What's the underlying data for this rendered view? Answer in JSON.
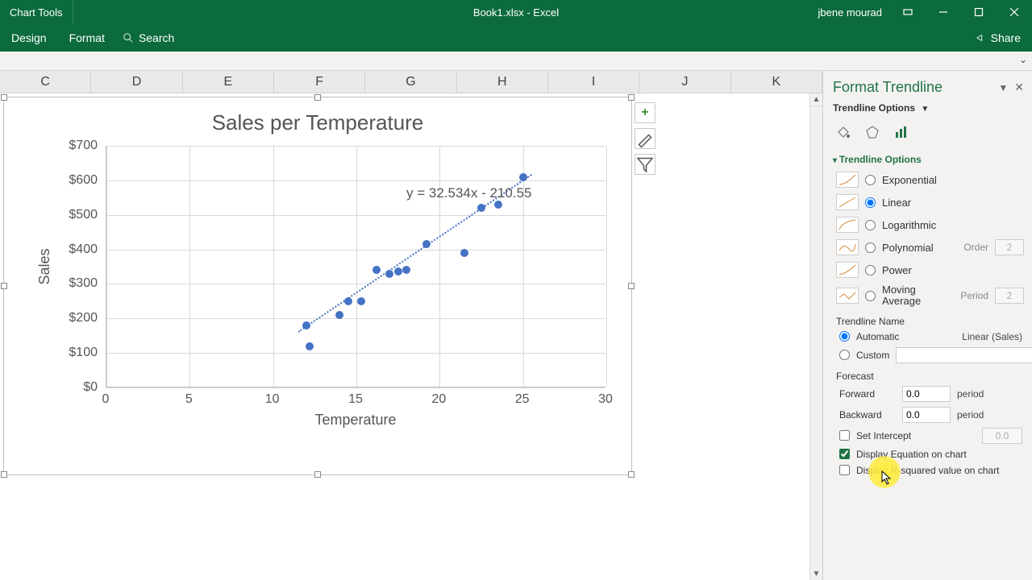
{
  "titlebar": {
    "tools_label": "Chart Tools",
    "doc_name": "Book1.xlsx  -  Excel",
    "user": "jbene mourad"
  },
  "menu": {
    "design": "Design",
    "format": "Format",
    "search": "Search",
    "share": "Share"
  },
  "columns": [
    "C",
    "D",
    "E",
    "F",
    "G",
    "H",
    "I",
    "J",
    "K"
  ],
  "chart_side": {
    "add": "+",
    "brush": "brush",
    "filter": "filter"
  },
  "chart_data": {
    "type": "scatter",
    "title": "Sales per Temperature",
    "xlabel": "Temperature",
    "ylabel": "Sales",
    "xlim": [
      0,
      30
    ],
    "ylim": [
      0,
      700
    ],
    "xticks": [
      0,
      5,
      10,
      15,
      20,
      25,
      30
    ],
    "yticks": [
      0,
      100,
      200,
      300,
      400,
      500,
      600,
      700
    ],
    "ytick_labels": [
      "$0",
      "$100",
      "$200",
      "$300",
      "$400",
      "$500",
      "$600",
      "$700"
    ],
    "series": [
      {
        "name": "Sales",
        "points": [
          {
            "x": 12.0,
            "y": 180
          },
          {
            "x": 12.2,
            "y": 120
          },
          {
            "x": 14.0,
            "y": 210
          },
          {
            "x": 14.5,
            "y": 250
          },
          {
            "x": 15.3,
            "y": 250
          },
          {
            "x": 16.2,
            "y": 340
          },
          {
            "x": 17.0,
            "y": 330
          },
          {
            "x": 17.5,
            "y": 335
          },
          {
            "x": 18.0,
            "y": 340
          },
          {
            "x": 19.2,
            "y": 415
          },
          {
            "x": 22.5,
            "y": 520
          },
          {
            "x": 23.5,
            "y": 530
          },
          {
            "x": 21.5,
            "y": 390
          },
          {
            "x": 25.0,
            "y": 610
          }
        ]
      }
    ],
    "trendline": {
      "type": "linear",
      "equation": "y = 32.534x - 210.55",
      "slope": 32.534,
      "intercept": -210.55
    }
  },
  "pane": {
    "title": "Format Trendline",
    "options_label": "Trendline Options",
    "section": "Trendline Options",
    "types": {
      "exponential": "Exponential",
      "linear": "Linear",
      "logarithmic": "Logarithmic",
      "polynomial": "Polynomial",
      "power": "Power",
      "moving_average": "Moving Average"
    },
    "poly_order_label": "Order",
    "poly_order_value": "2",
    "ma_period_label": "Period",
    "ma_period_value": "2",
    "trendline_name_hdr": "Trendline Name",
    "name_auto": "Automatic",
    "name_auto_value": "Linear (Sales)",
    "name_custom": "Custom",
    "forecast_hdr": "Forecast",
    "forward": "Forward",
    "forward_val": "0.0",
    "backward": "Backward",
    "backward_val": "0.0",
    "period": "period",
    "set_intercept": "Set Intercept",
    "set_intercept_val": "0.0",
    "display_eq": "Display Equation on chart",
    "display_r2": "Display R-squared value on chart"
  }
}
